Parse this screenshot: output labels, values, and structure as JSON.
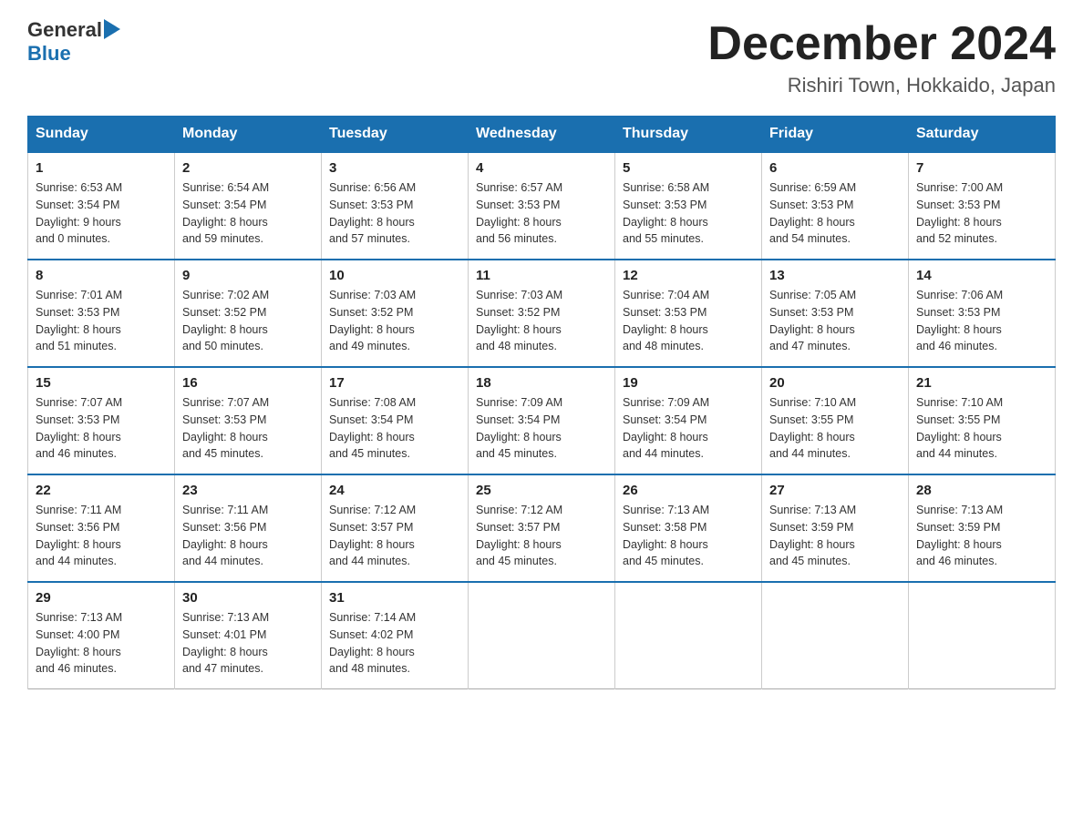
{
  "logo": {
    "general": "General",
    "blue": "Blue"
  },
  "title": "December 2024",
  "subtitle": "Rishiri Town, Hokkaido, Japan",
  "headers": [
    "Sunday",
    "Monday",
    "Tuesday",
    "Wednesday",
    "Thursday",
    "Friday",
    "Saturday"
  ],
  "weeks": [
    [
      {
        "day": "1",
        "sunrise": "6:53 AM",
        "sunset": "3:54 PM",
        "daylight": "9 hours and 0 minutes."
      },
      {
        "day": "2",
        "sunrise": "6:54 AM",
        "sunset": "3:54 PM",
        "daylight": "8 hours and 59 minutes."
      },
      {
        "day": "3",
        "sunrise": "6:56 AM",
        "sunset": "3:53 PM",
        "daylight": "8 hours and 57 minutes."
      },
      {
        "day": "4",
        "sunrise": "6:57 AM",
        "sunset": "3:53 PM",
        "daylight": "8 hours and 56 minutes."
      },
      {
        "day": "5",
        "sunrise": "6:58 AM",
        "sunset": "3:53 PM",
        "daylight": "8 hours and 55 minutes."
      },
      {
        "day": "6",
        "sunrise": "6:59 AM",
        "sunset": "3:53 PM",
        "daylight": "8 hours and 54 minutes."
      },
      {
        "day": "7",
        "sunrise": "7:00 AM",
        "sunset": "3:53 PM",
        "daylight": "8 hours and 52 minutes."
      }
    ],
    [
      {
        "day": "8",
        "sunrise": "7:01 AM",
        "sunset": "3:53 PM",
        "daylight": "8 hours and 51 minutes."
      },
      {
        "day": "9",
        "sunrise": "7:02 AM",
        "sunset": "3:52 PM",
        "daylight": "8 hours and 50 minutes."
      },
      {
        "day": "10",
        "sunrise": "7:03 AM",
        "sunset": "3:52 PM",
        "daylight": "8 hours and 49 minutes."
      },
      {
        "day": "11",
        "sunrise": "7:03 AM",
        "sunset": "3:52 PM",
        "daylight": "8 hours and 48 minutes."
      },
      {
        "day": "12",
        "sunrise": "7:04 AM",
        "sunset": "3:53 PM",
        "daylight": "8 hours and 48 minutes."
      },
      {
        "day": "13",
        "sunrise": "7:05 AM",
        "sunset": "3:53 PM",
        "daylight": "8 hours and 47 minutes."
      },
      {
        "day": "14",
        "sunrise": "7:06 AM",
        "sunset": "3:53 PM",
        "daylight": "8 hours and 46 minutes."
      }
    ],
    [
      {
        "day": "15",
        "sunrise": "7:07 AM",
        "sunset": "3:53 PM",
        "daylight": "8 hours and 46 minutes."
      },
      {
        "day": "16",
        "sunrise": "7:07 AM",
        "sunset": "3:53 PM",
        "daylight": "8 hours and 45 minutes."
      },
      {
        "day": "17",
        "sunrise": "7:08 AM",
        "sunset": "3:54 PM",
        "daylight": "8 hours and 45 minutes."
      },
      {
        "day": "18",
        "sunrise": "7:09 AM",
        "sunset": "3:54 PM",
        "daylight": "8 hours and 45 minutes."
      },
      {
        "day": "19",
        "sunrise": "7:09 AM",
        "sunset": "3:54 PM",
        "daylight": "8 hours and 44 minutes."
      },
      {
        "day": "20",
        "sunrise": "7:10 AM",
        "sunset": "3:55 PM",
        "daylight": "8 hours and 44 minutes."
      },
      {
        "day": "21",
        "sunrise": "7:10 AM",
        "sunset": "3:55 PM",
        "daylight": "8 hours and 44 minutes."
      }
    ],
    [
      {
        "day": "22",
        "sunrise": "7:11 AM",
        "sunset": "3:56 PM",
        "daylight": "8 hours and 44 minutes."
      },
      {
        "day": "23",
        "sunrise": "7:11 AM",
        "sunset": "3:56 PM",
        "daylight": "8 hours and 44 minutes."
      },
      {
        "day": "24",
        "sunrise": "7:12 AM",
        "sunset": "3:57 PM",
        "daylight": "8 hours and 44 minutes."
      },
      {
        "day": "25",
        "sunrise": "7:12 AM",
        "sunset": "3:57 PM",
        "daylight": "8 hours and 45 minutes."
      },
      {
        "day": "26",
        "sunrise": "7:13 AM",
        "sunset": "3:58 PM",
        "daylight": "8 hours and 45 minutes."
      },
      {
        "day": "27",
        "sunrise": "7:13 AM",
        "sunset": "3:59 PM",
        "daylight": "8 hours and 45 minutes."
      },
      {
        "day": "28",
        "sunrise": "7:13 AM",
        "sunset": "3:59 PM",
        "daylight": "8 hours and 46 minutes."
      }
    ],
    [
      {
        "day": "29",
        "sunrise": "7:13 AM",
        "sunset": "4:00 PM",
        "daylight": "8 hours and 46 minutes."
      },
      {
        "day": "30",
        "sunrise": "7:13 AM",
        "sunset": "4:01 PM",
        "daylight": "8 hours and 47 minutes."
      },
      {
        "day": "31",
        "sunrise": "7:14 AM",
        "sunset": "4:02 PM",
        "daylight": "8 hours and 48 minutes."
      },
      null,
      null,
      null,
      null
    ]
  ],
  "labels": {
    "sunrise": "Sunrise:",
    "sunset": "Sunset:",
    "daylight": "Daylight:"
  }
}
